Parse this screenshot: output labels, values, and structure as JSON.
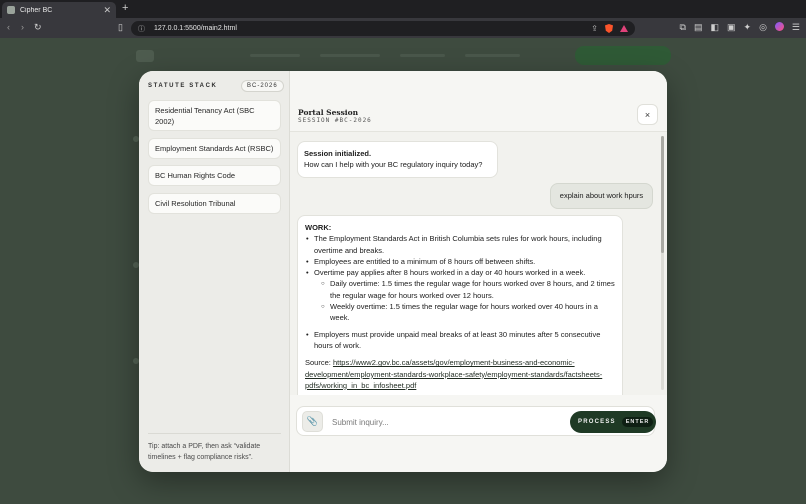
{
  "browser": {
    "tab_title": "Cipher BC",
    "new_tab": "+",
    "url": "127.0.0.1:5500/main2.html"
  },
  "modal": {
    "sidebar": {
      "heading": "STATUTE STACK",
      "badge": "BC-2026",
      "items": [
        {
          "label": "Residential Tenancy Act (SBC 2002)"
        },
        {
          "label": "Employment Standards Act (RSBC)"
        },
        {
          "label": "BC Human Rights Code"
        },
        {
          "label": "Civil Resolution Tribunal"
        }
      ],
      "tip": "Tip: attach a PDF, then ask “validate timelines + flag compliance risks”."
    },
    "header": {
      "title": "Portal Session",
      "subtitle": "SESSION #BC-2026",
      "close": "×"
    },
    "messages": {
      "system": {
        "title": "Session initialized.",
        "text": "How can I help with your BC regulatory inquiry today?"
      },
      "user": {
        "text": "explain about work hpurs"
      },
      "assistant": {
        "heading": "WORK:",
        "bullets": [
          "The Employment Standards Act in British Columbia sets rules for work hours, including overtime and breaks.",
          "Employees are entitled to a minimum of 8 hours off between shifts.",
          "Overtime pay applies after 8 hours worked in a day or 40 hours worked in a week."
        ],
        "sub_bullets": [
          "Daily overtime: 1.5 times the regular wage for hours worked over 8 hours, and 2 times the regular wage for hours worked over 12 hours.",
          "Weekly overtime: 1.5 times the regular wage for hours worked over 40 hours in a week."
        ],
        "bullet_last": "Employers must provide unpaid meal breaks of at least 30 minutes after 5 consecutive hours of work.",
        "source_label": "Source:",
        "source_url": "https://www2.gov.bc.ca/assets/gov/employment-business-and-economic-development/employment-standards-workplace-safety/employment-standards/factsheets-pdfs/working_in_bc_infosheet.pdf"
      }
    },
    "composer": {
      "placeholder": "Submit inquiry...",
      "process_label": "PROCESS",
      "enter_label": "ENTER"
    }
  },
  "icons": {
    "attach": "paperclip-icon",
    "close": "close-icon"
  }
}
